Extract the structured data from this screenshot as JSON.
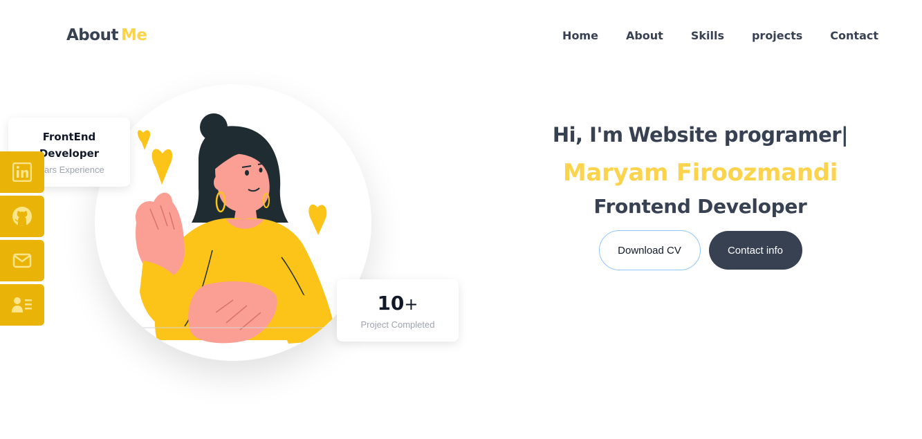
{
  "header": {
    "logo_main": "About",
    "logo_accent": "Me",
    "nav": [
      {
        "label": "Home"
      },
      {
        "label": "About"
      },
      {
        "label": "Skills"
      },
      {
        "label": "projects"
      },
      {
        "label": "Contact"
      }
    ]
  },
  "experience_card": {
    "title_line1": "FrontEnd",
    "title_line2": "Developer",
    "subtitle": "Years Experience"
  },
  "projects_card": {
    "number": "10",
    "suffix": "+",
    "label": "Project Completed"
  },
  "social": [
    {
      "icon": "linkedin-icon"
    },
    {
      "icon": "github-icon"
    },
    {
      "icon": "mail-icon"
    },
    {
      "icon": "contact-card-icon"
    }
  ],
  "hero": {
    "greeting": "Hi, I'm",
    "typed_text": "Website programer|",
    "name": "Maryam Firoozmandi",
    "role": "Frontend Developer",
    "download_label": "Download CV",
    "contact_label": "Contact info"
  },
  "colors": {
    "accent": "#fcd34d",
    "social_bg": "#eab308",
    "dark": "#374151",
    "outline_border": "#93c5fd"
  },
  "illustration": {
    "icon": "woman-heart-gesture-illustration"
  }
}
